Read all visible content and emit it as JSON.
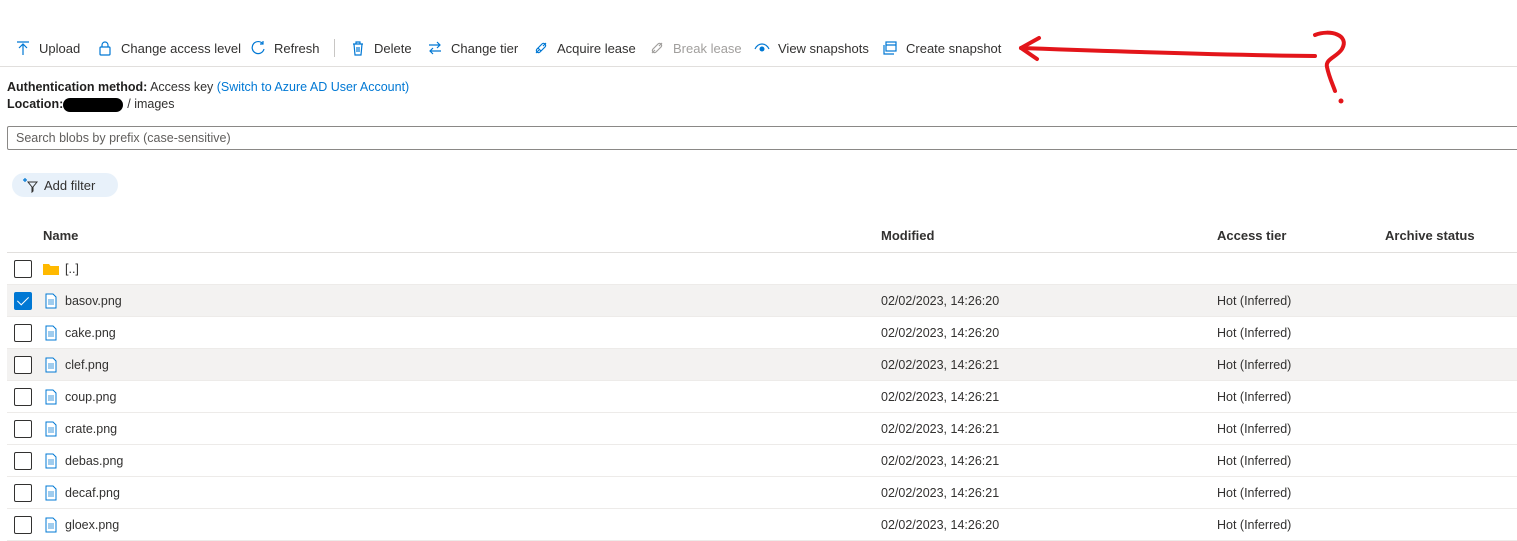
{
  "toolbar": {
    "upload": "Upload",
    "change_access": "Change access level",
    "refresh": "Refresh",
    "delete": "Delete",
    "change_tier": "Change tier",
    "acquire_lease": "Acquire lease",
    "break_lease": "Break lease",
    "view_snapshots": "View snapshots",
    "create_snapshot": "Create snapshot"
  },
  "info": {
    "auth_label": "Authentication method:",
    "auth_value": "Access key",
    "auth_link": "(Switch to Azure AD User Account)",
    "location_label": "Location:",
    "location_path": "/ images"
  },
  "search": {
    "placeholder": "Search blobs by prefix (case-sensitive)"
  },
  "filter": {
    "label": "Add filter"
  },
  "columns": {
    "name": "Name",
    "modified": "Modified",
    "access_tier": "Access tier",
    "archive_status": "Archive status"
  },
  "rows": [
    {
      "name": "[..]",
      "modified": "",
      "tier": "",
      "type": "folder",
      "checked": false
    },
    {
      "name": "basov.png",
      "modified": "02/02/2023, 14:26:20",
      "tier": "Hot (Inferred)",
      "type": "file",
      "checked": true
    },
    {
      "name": "cake.png",
      "modified": "02/02/2023, 14:26:20",
      "tier": "Hot (Inferred)",
      "type": "file",
      "checked": false
    },
    {
      "name": "clef.png",
      "modified": "02/02/2023, 14:26:21",
      "tier": "Hot (Inferred)",
      "type": "file",
      "checked": false
    },
    {
      "name": "coup.png",
      "modified": "02/02/2023, 14:26:21",
      "tier": "Hot (Inferred)",
      "type": "file",
      "checked": false
    },
    {
      "name": "crate.png",
      "modified": "02/02/2023, 14:26:21",
      "tier": "Hot (Inferred)",
      "type": "file",
      "checked": false
    },
    {
      "name": "debas.png",
      "modified": "02/02/2023, 14:26:21",
      "tier": "Hot (Inferred)",
      "type": "file",
      "checked": false
    },
    {
      "name": "decaf.png",
      "modified": "02/02/2023, 14:26:21",
      "tier": "Hot (Inferred)",
      "type": "file",
      "checked": false
    },
    {
      "name": "gloex.png",
      "modified": "02/02/2023, 14:26:20",
      "tier": "Hot (Inferred)",
      "type": "file",
      "checked": false
    }
  ],
  "colors": {
    "accent": "#0078d4",
    "annotation": "#e3151a",
    "folder": "#ffb900",
    "selected_row": "#f3f2f1"
  }
}
